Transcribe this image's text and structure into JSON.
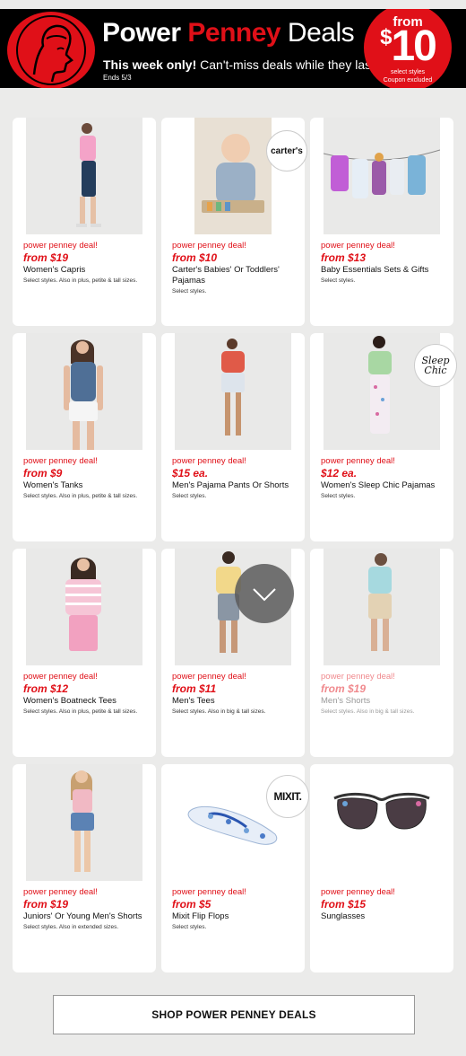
{
  "header": {
    "title_part1": "Power ",
    "title_part2": "Penney",
    "title_part3": " Deals",
    "tagline_bold": "This week only!",
    "tagline_rest": " Can't-miss deals while they last!",
    "ends": "Ends 5/3",
    "badge_from": "from",
    "badge_dollar": "$",
    "badge_amount": "10",
    "badge_select": "select styles",
    "badge_coupon": "Coupon excluded"
  },
  "products": [
    {
      "deal": "power penney deal!",
      "price": "from $19",
      "name": "Women's Capris",
      "note": "Select styles. Also in plus, petite & tall sizes."
    },
    {
      "deal": "power penney deal!",
      "price": "from $10",
      "name": "Carter's Babies' Or Toddlers' Pajamas",
      "note": "Select styles.",
      "brand": "carter's"
    },
    {
      "deal": "power penney deal!",
      "price": "from $13",
      "name": "Baby Essentials Sets & Gifts",
      "note": "Select styles."
    },
    {
      "deal": "power penney deal!",
      "price": "from $9",
      "name": "Women's Tanks",
      "note": "Select styles. Also in plus, petite & tall sizes."
    },
    {
      "deal": "power penney deal!",
      "price": "$15 ea.",
      "name": "Men's Pajama Pants Or Shorts",
      "note": "Select styles."
    },
    {
      "deal": "power penney deal!",
      "price": "$12 ea.",
      "name": "Women's Sleep Chic Pajamas",
      "note": "Select styles.",
      "brand": "Sleep Chic"
    },
    {
      "deal": "power penney deal!",
      "price": "from $12",
      "name": "Women's Boatneck Tees",
      "note": "Select styles. Also in plus, petite & tall sizes."
    },
    {
      "deal": "power penney deal!",
      "price": "from $11",
      "name": "Men's Tees",
      "note": "Select styles. Also in big & tall sizes."
    },
    {
      "deal": "power penney deal!",
      "price": "from $19",
      "name": "Men's Shorts",
      "note": "Select styles. Also in big & tall sizes."
    },
    {
      "deal": "power penney deal!",
      "price": "from $19",
      "name": "Juniors' Or Young Men's Shorts",
      "note": "Select styles. Also in extended sizes."
    },
    {
      "deal": "power penney deal!",
      "price": "from $5",
      "name": "Mixit Flip Flops",
      "note": "Select styles.",
      "brand": "MIXIT."
    },
    {
      "deal": "power penney deal!",
      "price": "from $15",
      "name": "Sunglasses",
      "note": ""
    }
  ],
  "cta": {
    "label": "SHOP POWER PENNEY DEALS"
  },
  "icons": {
    "scroll": "chevron-down-icon",
    "logo": "jc-penney-portrait-logo"
  },
  "colors": {
    "brand_red": "#e01018",
    "header_bg": "#000000"
  }
}
